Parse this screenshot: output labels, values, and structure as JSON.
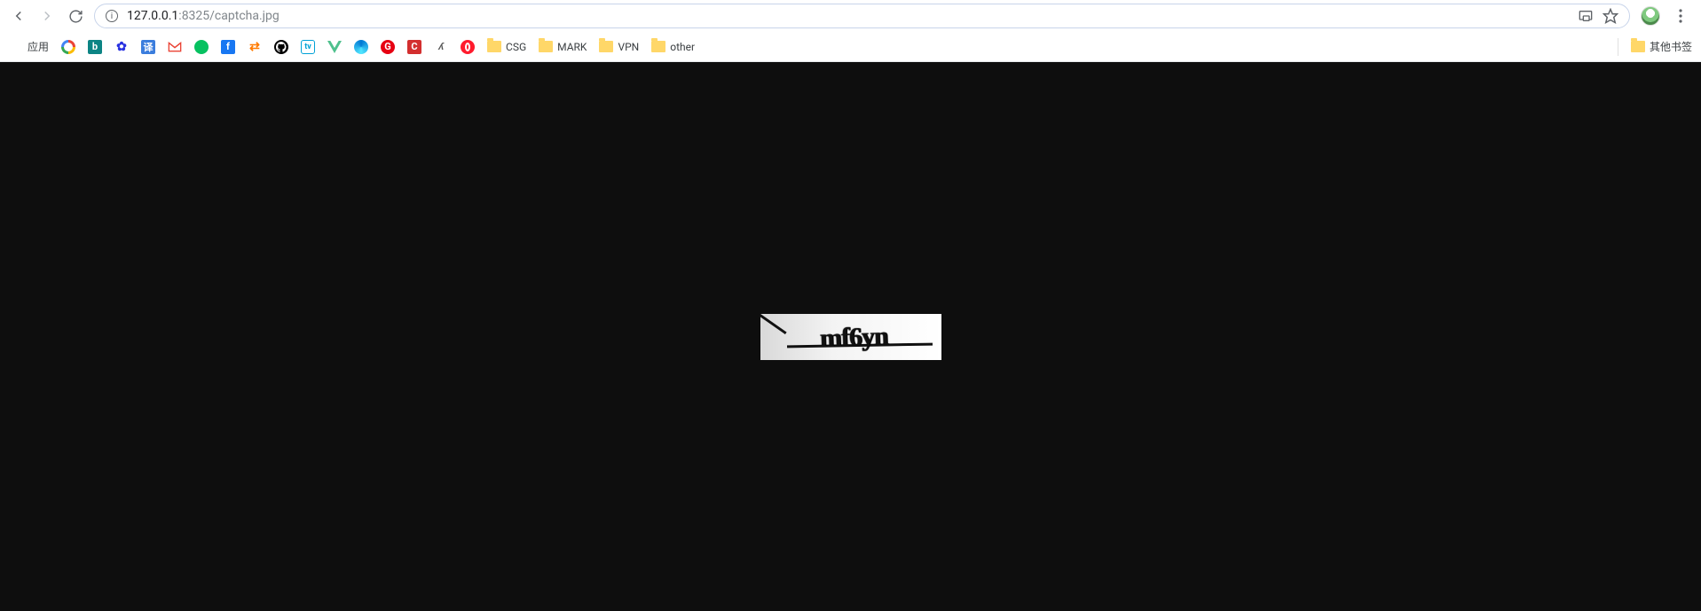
{
  "omnibox": {
    "url_prefix": "127.0.0.1",
    "url_suffix": ":8325/captcha.jpg"
  },
  "bookmarks": {
    "apps_label": "应用",
    "folder_labels": [
      "CSG",
      "MARK",
      "VPN",
      "other"
    ],
    "other_label": "其他书签"
  },
  "captcha": {
    "text": "mf6yn"
  }
}
